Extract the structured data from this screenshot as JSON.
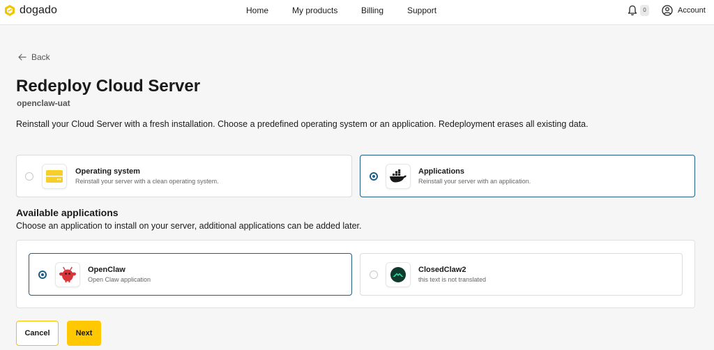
{
  "header": {
    "logo_text": "dogado",
    "nav": [
      "Home",
      "My products",
      "Billing",
      "Support"
    ],
    "notification_count": "0",
    "account_label": "Account"
  },
  "back_label": "Back",
  "page_title": "Redeploy Cloud Server",
  "server_name": "openclaw-uat",
  "description": "Reinstall your Cloud Server with a fresh installation. Choose a predefined operating system or an application. Redeployment erases all existing data.",
  "install_types": [
    {
      "title": "Operating system",
      "subtitle": "Reinstall your server with a clean operating system.",
      "selected": false,
      "icon": "os-card-icon"
    },
    {
      "title": "Applications",
      "subtitle": "Reinstall your server with an application.",
      "selected": true,
      "icon": "docker-icon"
    }
  ],
  "apps_section": {
    "title": "Available applications",
    "description": "Choose an application to install on your server, additional applications can be added later."
  },
  "apps": [
    {
      "title": "OpenClaw",
      "subtitle": "Open Claw application",
      "selected": true,
      "icon": "openclaw-icon"
    },
    {
      "title": "ClosedClaw2",
      "subtitle": "this text is not translated",
      "selected": false,
      "icon": "closedclaw-icon"
    }
  ],
  "buttons": {
    "cancel": "Cancel",
    "next": "Next"
  },
  "colors": {
    "accent": "#ffc800",
    "selected_border": "#1e5e85",
    "openclaw_red": "#d8343a",
    "closedclaw_green": "#0f3a2d"
  }
}
